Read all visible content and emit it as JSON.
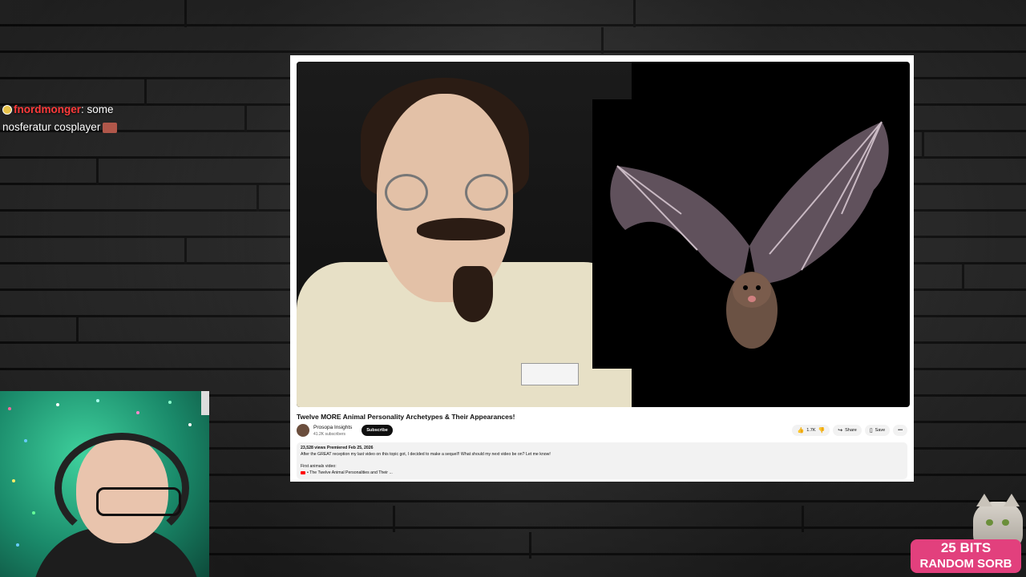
{
  "chat": {
    "username": "fnordmonger",
    "message_line1": ": some",
    "message_line2": "nosferatur cosplayer"
  },
  "video": {
    "title": "Twelve MORE Animal Personality Archetypes & Their Appearances!",
    "channel_name": "Prosopa Insights",
    "subscribers": "41.2K subscribers",
    "subscribe_label": "Subscribe",
    "likes": "1.7K",
    "share_label": "Share",
    "save_label": "Save",
    "more_label": "•••",
    "stats": "23,528 views  Premiered Feb 25, 2026",
    "description": "After the GREAT reception my last video on this topic got, I decided to make a sequel!! What should my next video be on? Let me know!",
    "desc_label": "First animals video:",
    "desc_link": "• The Twelve Animal Personalities and Their ..."
  },
  "alert": {
    "line1": "25 BITS",
    "line2": "RANDOM SORB"
  },
  "colors": {
    "chat_username": "#ff3b3b",
    "alert_bg": "#e2407d",
    "youtube_red": "#ff0000"
  }
}
